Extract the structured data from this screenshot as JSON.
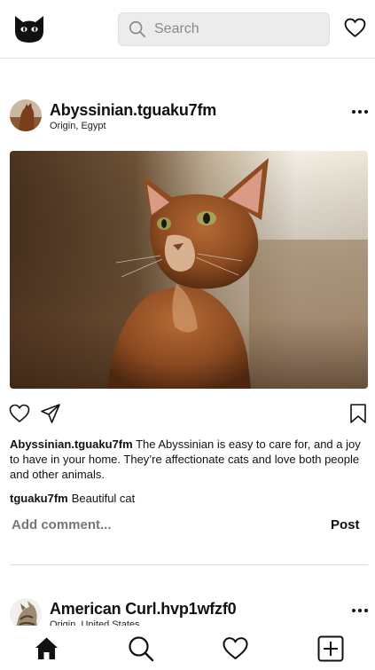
{
  "header": {
    "logo_icon": "cat-face-icon",
    "search": {
      "placeholder": "Search",
      "icon": "search-icon"
    },
    "heart_icon": "heart-outline-icon"
  },
  "posts": [
    {
      "username": "Abyssinian.tguaku7fm",
      "origin": "Origin, Egypt",
      "caption_user": "Abyssinian.tguaku7fm",
      "caption_text": " The Abyssinian is easy to care for, and a joy to have in your home. They’re affectionate cats and love both people and other animals.",
      "comments": [
        {
          "user": "tguaku7fm",
          "text": "Beautiful cat"
        }
      ],
      "add_comment_placeholder": "Add comment...",
      "post_label": "Post"
    },
    {
      "username": "American Curl.hvp1wfzf0",
      "origin": "Origin, United States"
    }
  ],
  "bottom_nav": {
    "items": [
      "home-icon",
      "search-icon",
      "heart-icon",
      "add-post-icon"
    ]
  }
}
